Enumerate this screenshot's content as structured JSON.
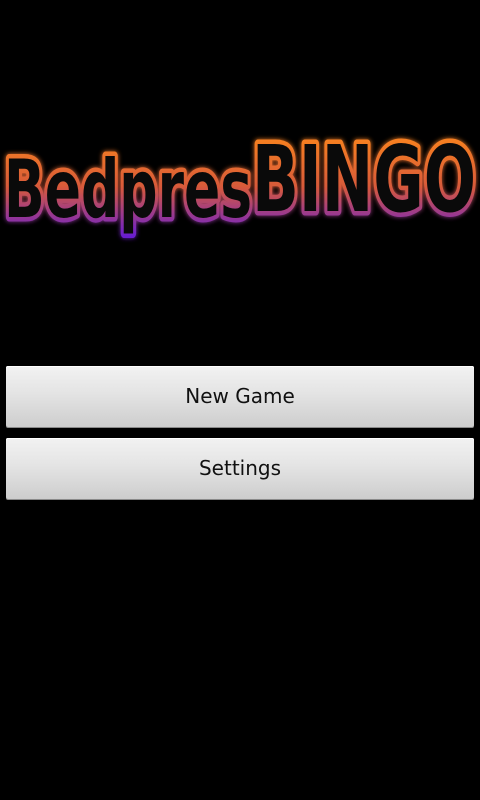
{
  "logo": {
    "text_part1": "Bedpres",
    "text_part2": "BINGO",
    "color_top": "#ff8a1a",
    "color_bottom": "#6a1fd0",
    "outline_color": "#e8621a"
  },
  "menu": {
    "new_game_label": "New Game",
    "settings_label": "Settings"
  }
}
